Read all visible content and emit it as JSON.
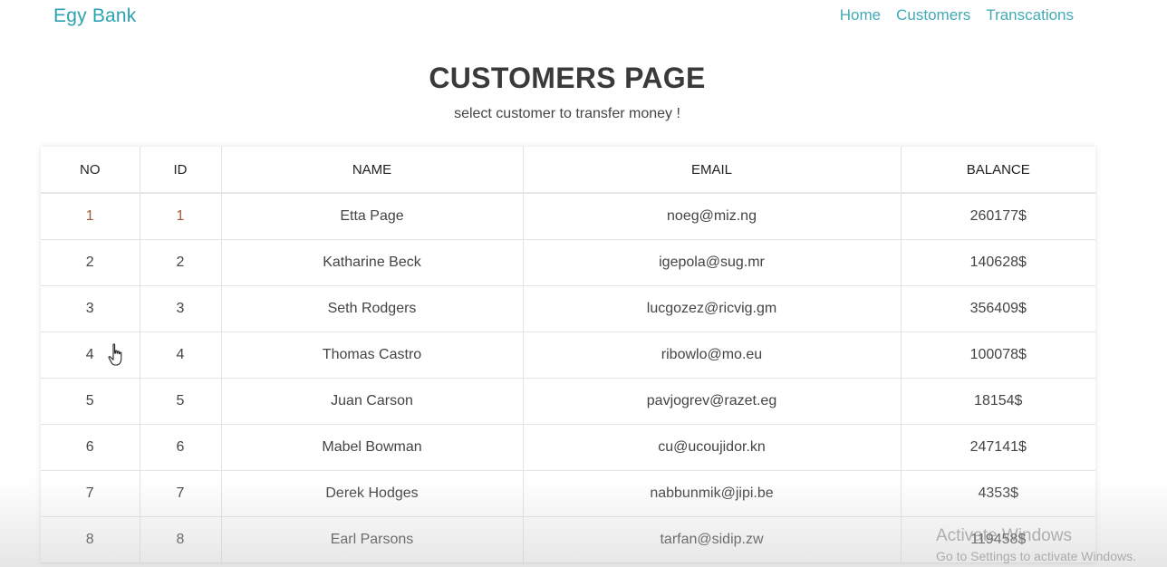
{
  "navbar": {
    "brand": "Egy Bank",
    "links": [
      "Home",
      "Customers",
      "Transcations"
    ]
  },
  "page": {
    "title": "CUSTOMERS PAGE",
    "subtitle": "select customer to transfer money !"
  },
  "table": {
    "headers": [
      "NO",
      "ID",
      "NAME",
      "EMAIL",
      "BALANCE"
    ],
    "rows": [
      {
        "no": "1",
        "id": "1",
        "name": "Etta Page",
        "email": "noeg@miz.ng",
        "balance": "260177$"
      },
      {
        "no": "2",
        "id": "2",
        "name": "Katharine Beck",
        "email": "igepola@sug.mr",
        "balance": "140628$"
      },
      {
        "no": "3",
        "id": "3",
        "name": "Seth Rodgers",
        "email": "lucgozez@ricvig.gm",
        "balance": "356409$"
      },
      {
        "no": "4",
        "id": "4",
        "name": "Thomas Castro",
        "email": "ribowlo@mo.eu",
        "balance": "100078$"
      },
      {
        "no": "5",
        "id": "5",
        "name": "Juan Carson",
        "email": "pavjogrev@razet.eg",
        "balance": "18154$"
      },
      {
        "no": "6",
        "id": "6",
        "name": "Mabel Bowman",
        "email": "cu@ucoujidor.kn",
        "balance": "247141$"
      },
      {
        "no": "7",
        "id": "7",
        "name": "Derek Hodges",
        "email": "nabbunmik@jipi.be",
        "balance": "4353$"
      },
      {
        "no": "8",
        "id": "8",
        "name": "Earl Parsons",
        "email": "tarfan@sidip.zw",
        "balance": "119458$"
      }
    ]
  },
  "watermark": {
    "title": "Activate Windows",
    "subtitle": "Go to Settings to activate Windows."
  },
  "colors": {
    "brand": "#2aa3b0",
    "nav_link": "#42aab6"
  },
  "icons": {
    "cursor": "hand-pointer-icon"
  }
}
